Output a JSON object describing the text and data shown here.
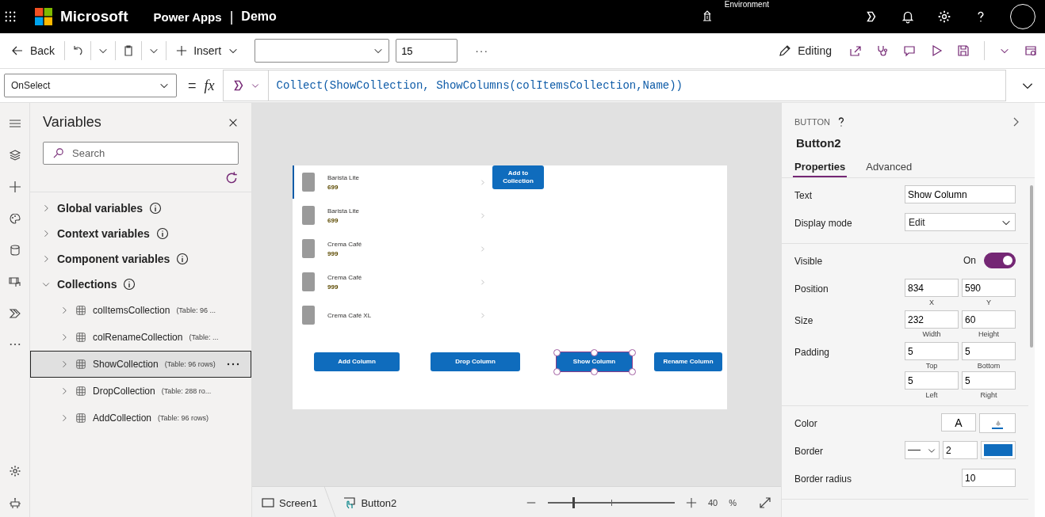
{
  "top_bar": {
    "brand": "Microsoft",
    "app_name": "Power Apps",
    "separator": "|",
    "app_title": "Demo",
    "environment_label": "Environment"
  },
  "toolbar": {
    "back": "Back",
    "insert": "Insert",
    "font_size": "15",
    "more": "···",
    "editing": "Editing"
  },
  "formula_bar": {
    "property": "OnSelect",
    "equals": "=",
    "fx": "fx",
    "formula": "Collect(ShowCollection, ShowColumns(colItemsCollection,Name))"
  },
  "variables_panel": {
    "title": "Variables",
    "search": {
      "placeholder": "Search"
    },
    "groups": [
      {
        "label": "Global variables",
        "expanded": false
      },
      {
        "label": "Context variables",
        "expanded": false
      },
      {
        "label": "Component variables",
        "expanded": false
      },
      {
        "label": "Collections",
        "expanded": true,
        "children": [
          {
            "name": "colItemsCollection",
            "detail": "(Table: 96 ...",
            "selected": false
          },
          {
            "name": "colRenameCollection",
            "detail": "(Table: ...",
            "selected": false
          },
          {
            "name": "ShowCollection",
            "detail": "(Table: 96 rows)",
            "selected": true
          },
          {
            "name": "DropCollection",
            "detail": "(Table: 288 ro...",
            "selected": false
          },
          {
            "name": "AddCollection",
            "detail": "(Table: 96 rows)",
            "selected": false
          }
        ]
      }
    ]
  },
  "canvas": {
    "gallery": [
      {
        "name": "Barista Lite",
        "price": "699",
        "selected": true
      },
      {
        "name": "Barista Lite",
        "price": "699",
        "selected": false
      },
      {
        "name": "Crema Café",
        "price": "999",
        "selected": false
      },
      {
        "name": "Crema Café",
        "price": "999",
        "selected": false
      },
      {
        "name": "Crema Café XL",
        "selected": false
      }
    ],
    "buttons": [
      {
        "label": "Add to Collection",
        "selected": false
      },
      {
        "label": "Add Column",
        "selected": false
      },
      {
        "label": "Drop Column",
        "selected": false
      },
      {
        "label": "Show Column",
        "selected": true
      },
      {
        "label": "Rename Column",
        "selected": false
      }
    ]
  },
  "status_bar": {
    "screen": "Screen1",
    "control": "Button2",
    "zoom": {
      "level": 0.2
    },
    "zoom_value": "40",
    "percent": "%"
  },
  "properties_panel": {
    "type_label": "BUTTON",
    "control_name": "Button2",
    "tabs": [
      {
        "label": "Properties",
        "selected": true
      },
      {
        "label": "Advanced",
        "selected": false
      }
    ],
    "sections": [
      [
        {
          "kind": "text",
          "label": "Text",
          "value": "Show Column"
        },
        {
          "kind": "dropdown",
          "label": "Display mode",
          "value": "Edit"
        }
      ],
      [
        {
          "kind": "toggle",
          "label": "Visible",
          "state_label": "On",
          "on": true
        },
        {
          "kind": "fields",
          "label": "Position",
          "fields": [
            {
              "value": "834",
              "caption": "X"
            },
            {
              "value": "590",
              "caption": "Y"
            }
          ]
        },
        {
          "kind": "fields",
          "label": "Size",
          "fields": [
            {
              "value": "232",
              "caption": "Width"
            },
            {
              "value": "60",
              "caption": "Height"
            }
          ]
        },
        {
          "kind": "fields",
          "label": "Padding",
          "fields": [
            {
              "value": "5",
              "caption": "Top"
            },
            {
              "value": "5",
              "caption": "Bottom"
            },
            {
              "value": "5",
              "caption": "Left"
            },
            {
              "value": "5",
              "caption": "Right"
            }
          ]
        }
      ],
      [
        {
          "kind": "color",
          "label": "Color",
          "font_glyph": "A"
        },
        {
          "kind": "border",
          "label": "Border",
          "value": "2",
          "color": "#0f6cbd"
        },
        {
          "kind": "small",
          "label": "Border radius",
          "value": "10"
        }
      ]
    ]
  }
}
